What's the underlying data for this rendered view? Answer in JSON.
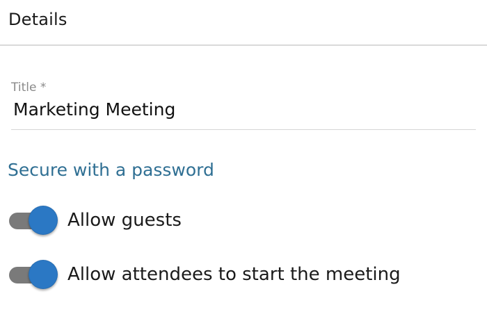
{
  "header": {
    "title": "Details"
  },
  "title_field": {
    "label": "Title *",
    "value": "Marketing Meeting"
  },
  "password_link": {
    "label": "Secure with a password"
  },
  "toggles": [
    {
      "label": "Allow guests",
      "on": true
    },
    {
      "label": "Allow attendees to start the meeting",
      "on": true
    }
  ],
  "colors": {
    "accent": "#2b78c4",
    "link": "#2f6f93",
    "toggle_track": "#7a7a7a",
    "divider": "#d9d9d9"
  }
}
